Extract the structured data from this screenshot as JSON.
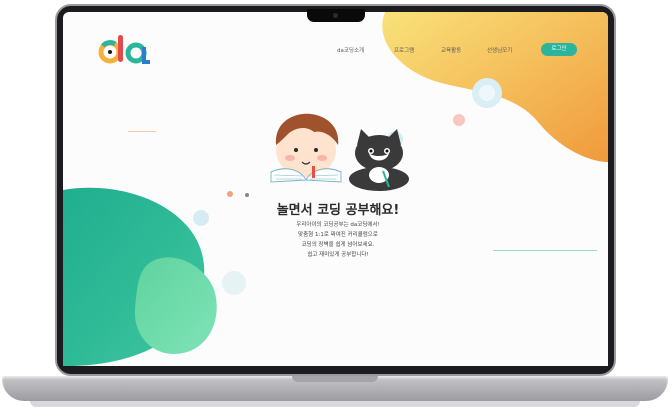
{
  "site": {
    "logo_text": "da",
    "nav": [
      "da코딩소개",
      "프로그램",
      "교육활동",
      "선생님모기"
    ],
    "login_label": "로그인"
  },
  "hero": {
    "headline": "놀면서 코딩 공부해요!",
    "description_lines": [
      "우리아이의 코딩공부는 da코딩에서!",
      "맞춤형 1:1로 짜여진 커리큘럼으로",
      "코딩의 장벽을 쉽게 넘어보세요.",
      "쉽고 재미있게 공부합니다!"
    ]
  },
  "colors": {
    "accent_green": "#2bb59c",
    "orange_blob": "#f2b14a",
    "teal_blob": "#1fae8f"
  }
}
